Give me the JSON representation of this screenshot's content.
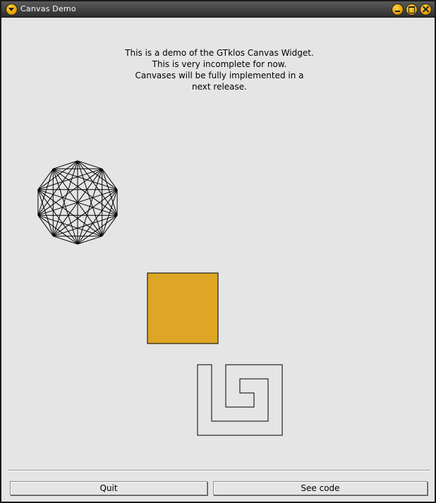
{
  "window": {
    "title": "Canvas Demo"
  },
  "intro": {
    "lines": [
      "This is a demo of the GTklos Canvas Widget.",
      "This is very incomplete for now.",
      "Canvases will be fully implemented in a",
      "next release."
    ]
  },
  "canvas": {
    "polygon": {
      "vertices": 10,
      "stroke": "#000000"
    },
    "square": {
      "fill": "#dda625",
      "stroke": "#000000"
    },
    "spiral": {
      "stroke": "#000000"
    }
  },
  "buttons": {
    "quit": "Quit",
    "see_code": "See code"
  }
}
